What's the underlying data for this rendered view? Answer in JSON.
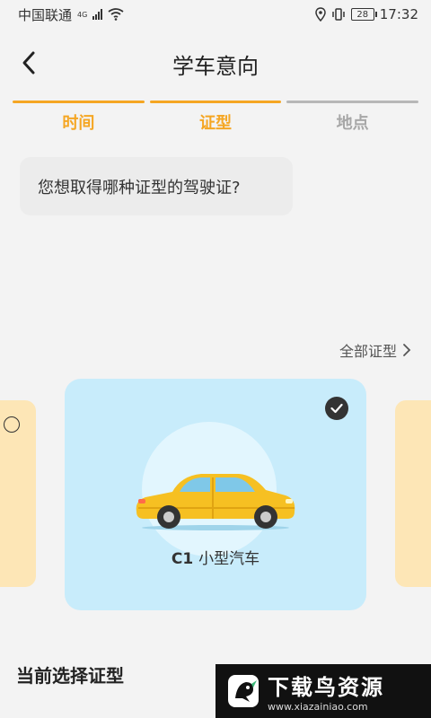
{
  "status_bar": {
    "carrier": "中国联通",
    "network": "4G",
    "battery": "28",
    "time": "17:32"
  },
  "header": {
    "title": "学车意向"
  },
  "steps": [
    {
      "label": "时间",
      "state": "done"
    },
    {
      "label": "证型",
      "state": "done"
    },
    {
      "label": "地点",
      "state": "pending"
    }
  ],
  "question": "您想取得哪种证型的驾驶证?",
  "all_types_link": "全部证型",
  "license_card": {
    "code": "C1",
    "name": "小型汽车",
    "selected": true
  },
  "current_selection_title": "当前选择证型",
  "watermark": {
    "text": "下载鸟资源",
    "url": "www.xiazainiao.com"
  },
  "colors": {
    "accent": "#f5a623",
    "card_bg": "#c8ecfb",
    "side_card_bg": "#fde6b6",
    "car_body": "#f6c022"
  }
}
